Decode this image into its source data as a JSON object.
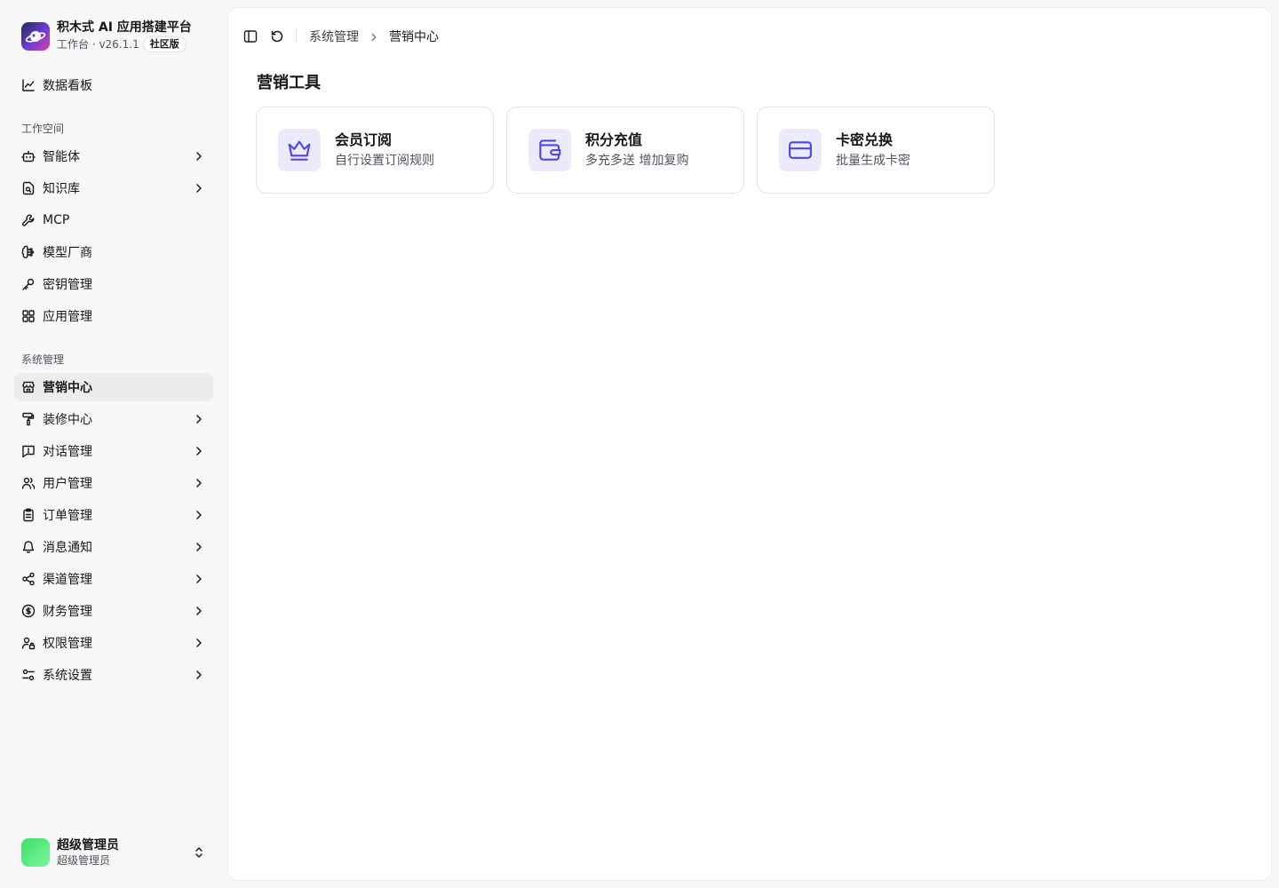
{
  "brand": {
    "title": "积木式 AI 应用搭建平台",
    "subtitle": "工作台 · v26.1.1",
    "edition": "社区版"
  },
  "nav": {
    "dashboard": {
      "label": "数据看板",
      "icon": "chart-line-icon"
    },
    "workspace_label": "工作空间",
    "workspace": [
      {
        "label": "智能体",
        "icon": "bot-icon",
        "expandable": true
      },
      {
        "label": "知识库",
        "icon": "book-search-icon",
        "expandable": true
      },
      {
        "label": "MCP",
        "icon": "wrench-icon",
        "expandable": false
      },
      {
        "label": "模型厂商",
        "icon": "brain-icon",
        "expandable": false
      },
      {
        "label": "密钥管理",
        "icon": "key-icon",
        "expandable": false
      },
      {
        "label": "应用管理",
        "icon": "grid-icon",
        "expandable": false
      }
    ],
    "system_label": "系统管理",
    "system": [
      {
        "label": "营销中心",
        "icon": "store-icon",
        "expandable": false,
        "active": true
      },
      {
        "label": "装修中心",
        "icon": "paint-roller-icon",
        "expandable": true
      },
      {
        "label": "对话管理",
        "icon": "message-icon",
        "expandable": true
      },
      {
        "label": "用户管理",
        "icon": "users-icon",
        "expandable": true
      },
      {
        "label": "订单管理",
        "icon": "clipboard-icon",
        "expandable": true
      },
      {
        "label": "消息通知",
        "icon": "bell-icon",
        "expandable": true
      },
      {
        "label": "渠道管理",
        "icon": "share-icon",
        "expandable": true
      },
      {
        "label": "财务管理",
        "icon": "dollar-circle-icon",
        "expandable": true
      },
      {
        "label": "权限管理",
        "icon": "user-lock-icon",
        "expandable": true
      },
      {
        "label": "系统设置",
        "icon": "settings-sliders-icon",
        "expandable": true
      }
    ]
  },
  "user": {
    "name": "超级管理员",
    "role": "超级管理员"
  },
  "breadcrumb": [
    "系统管理",
    "营销中心"
  ],
  "page": {
    "title": "营销工具",
    "cards": [
      {
        "title": "会员订阅",
        "desc": "自行设置订阅规则",
        "icon": "crown-icon"
      },
      {
        "title": "积分充值",
        "desc": "多充多送 增加复购",
        "icon": "wallet-icon"
      },
      {
        "title": "卡密兑换",
        "desc": "批量生成卡密",
        "icon": "credit-card-icon"
      }
    ]
  },
  "colors": {
    "accent": "#4f46e5",
    "card_icon_bg": "#ebebfb",
    "active_nav_bg": "#ededef"
  }
}
